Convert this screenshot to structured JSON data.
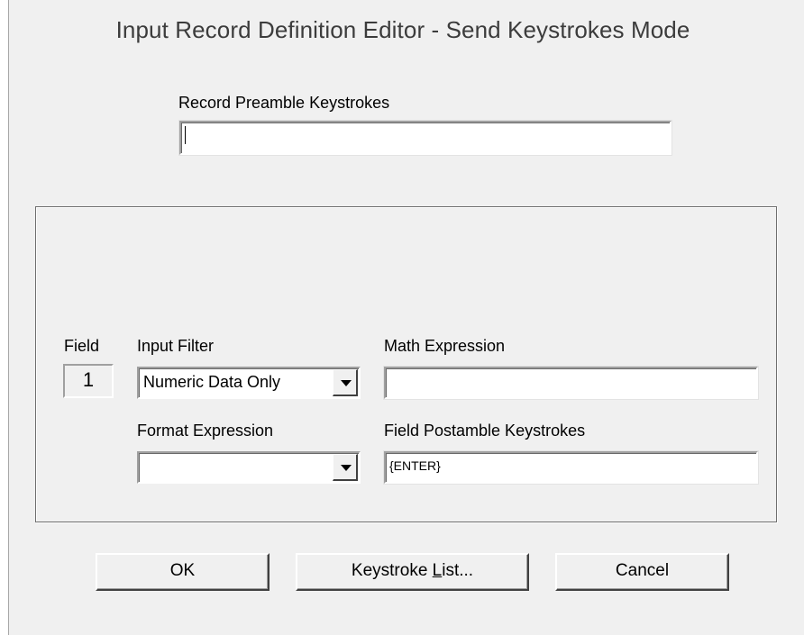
{
  "window": {
    "title": "Input Record Definition Editor - Send Keystrokes Mode"
  },
  "record_preamble": {
    "label": "Record Preamble Keystrokes",
    "value": ""
  },
  "field": {
    "label": "Field",
    "number": "1",
    "input_filter": {
      "label": "Input Filter",
      "value": "Numeric Data Only"
    },
    "math_expression": {
      "label": "Math Expression",
      "value": ""
    },
    "format_expression": {
      "label": "Format Expression",
      "value": ""
    },
    "field_postamble": {
      "label": "Field Postamble Keystrokes",
      "value": "{ENTER}"
    }
  },
  "buttons": {
    "ok": "OK",
    "keystroke_list_pre": "Keystroke ",
    "keystroke_list_accel": "L",
    "keystroke_list_post": "ist...",
    "cancel": "Cancel"
  }
}
